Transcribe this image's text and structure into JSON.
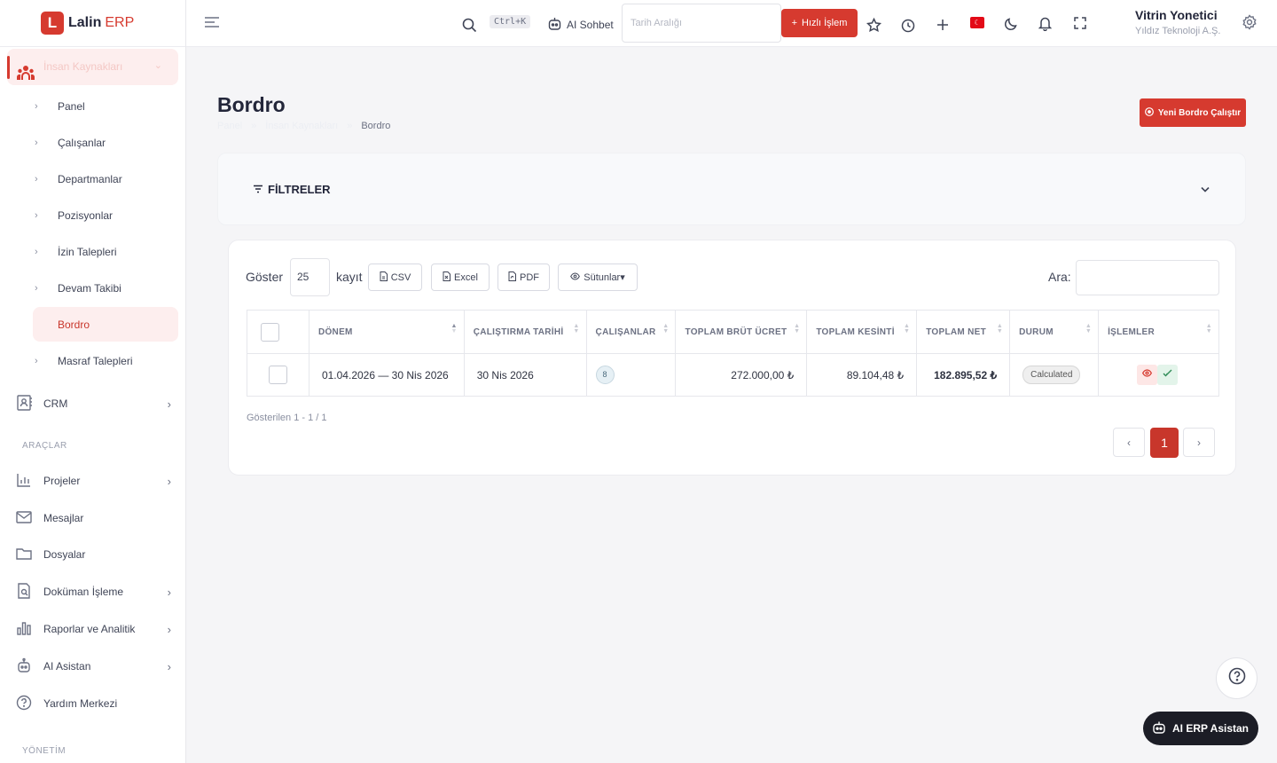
{
  "app": {
    "logo_letter": "L",
    "name": "Lalin",
    "suffix": "ERP"
  },
  "sidebar": {
    "group_label": "İnsan Kaynakları",
    "sub_items": [
      {
        "label": "Panel"
      },
      {
        "label": "Çalışanlar"
      },
      {
        "label": "Departmanlar"
      },
      {
        "label": "Pozisyonlar"
      },
      {
        "label": "İzin Talepleri"
      },
      {
        "label": "Devam Takibi"
      },
      {
        "label": "Bordro",
        "active": true
      },
      {
        "label": "Masraf Talepleri"
      }
    ],
    "crm_label": "CRM",
    "section_tools": "ARAÇLAR",
    "tools": [
      {
        "label": "Projeler",
        "icon": "chart-icon"
      },
      {
        "label": "Mesajlar",
        "icon": "mail-icon"
      },
      {
        "label": "Dosyalar",
        "icon": "folder-icon"
      },
      {
        "label": "Doküman İşleme",
        "icon": "doc-search-icon"
      },
      {
        "label": "Raporlar ve Analitik",
        "icon": "bar-chart-icon"
      },
      {
        "label": "AI Asistan",
        "icon": "robot-icon"
      },
      {
        "label": "Yardım Merkezi",
        "icon": "help-icon"
      }
    ],
    "section_admin": "YÖNETİM"
  },
  "header": {
    "shortcut": "Ctrl+K",
    "ai_chat": "AI Sohbet",
    "date_placeholder": "Tarih Aralığı",
    "quick_action": "Hızlı İşlem",
    "user_name": "Vitrin Yonetici",
    "company": "Yıldız Teknoloji A.Ş.",
    "flag_symbol": "☾"
  },
  "page": {
    "title": "Bordro",
    "breadcrumb": [
      "Panel",
      "İnsan Kaynakları",
      "Bordro"
    ],
    "new_run": "Yeni Bordro Çalıştır",
    "filters_title": "FİLTRELER"
  },
  "table": {
    "show_label": "Göster",
    "page_length": "25",
    "records_label": "kayıt",
    "buttons": {
      "csv": "CSV",
      "excel": "Excel",
      "pdf": "PDF",
      "columns": "Sütunlar▾"
    },
    "search_label": "Ara:",
    "headers": [
      "DÖNEM",
      "ÇALIŞTIRMA TARİHİ",
      "ÇALIŞANLAR",
      "TOPLAM BRÜT ÜCRET",
      "TOPLAM KESİNTİ",
      "TOPLAM NET",
      "DURUM",
      "İŞLEMLER"
    ],
    "rows": [
      {
        "period": "01.04.2026 — 30 Nis 2026",
        "run_date": "30 Nis 2026",
        "employees": "8",
        "gross": "272.000,00 ₺",
        "deductions": "89.104,48 ₺",
        "net": "182.895,52 ₺",
        "status": "Calculated"
      }
    ],
    "info": "Gösterilen 1 - 1 / 1",
    "pagination": {
      "prev": "‹",
      "current": "1",
      "next": "›"
    }
  },
  "fab": {
    "ai_label": "AI ERP Asistan",
    "help": "?"
  },
  "colors": {
    "accent": "#d63a2f",
    "active_bg": "#fdeeee",
    "dark": "#1c1d26"
  }
}
